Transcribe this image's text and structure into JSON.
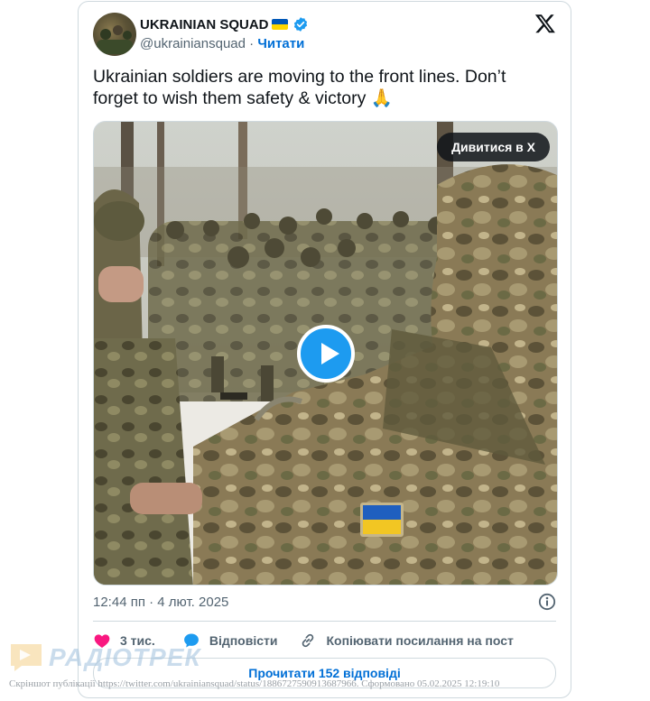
{
  "account": {
    "name": "UKRAINIAN SQUAD",
    "handle": "@ukrainiansquad",
    "separator": "·",
    "follow_label": "Читати",
    "flag_colors": [
      "#0057b7",
      "#ffd700"
    ],
    "verified_color": "#1d9bf0"
  },
  "tweet": {
    "text": "Ukrainian soldiers are moving to the front lines. Don’t forget to wish them safety & victory 🙏",
    "watch_on_x_label": "Дивитися в X",
    "timestamp": "12:44 пп · 4 лют. 2025"
  },
  "actions": {
    "likes": "3 тис.",
    "reply": "Відповісти",
    "copy_link": "Копіювати посилання на пост",
    "read_replies": "Прочитати 152 відповіді",
    "like_color": "#f91880",
    "accent": "#006fd6"
  },
  "watermark": {
    "logo_text": "РАДІОТРЕК",
    "caption": "Скріншот публікації https://twitter.com/ukrainiansquad/status/1886727590913687966. Сформовано 05.02.2025 12:19:10"
  }
}
